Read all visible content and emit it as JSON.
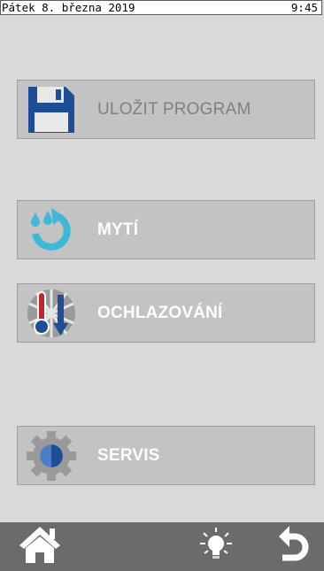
{
  "status_bar": {
    "date": "Pátek 8. března 2019",
    "time": "9:45"
  },
  "menu": {
    "save_program": {
      "label": "ULOŽIT PROGRAM",
      "icon": "floppy-disk-icon",
      "enabled": false
    },
    "wash": {
      "label": "MYTÍ",
      "icon": "wash-cycle-icon",
      "enabled": true
    },
    "cooling": {
      "label": "OCHLAZOVÁNÍ",
      "icon": "cooling-thermometer-icon",
      "enabled": true
    },
    "service": {
      "label": "SERVIS",
      "icon": "gear-icon",
      "enabled": true
    }
  },
  "bottom_bar": {
    "home": "home-icon",
    "light": "light-bulb-icon",
    "back": "back-arrow-icon"
  },
  "colors": {
    "background": "#d9d9d9",
    "button": "#c3c3c3",
    "bottom_bar": "#6b6b6b",
    "accent_blue": "#1f4e99",
    "accent_cyan": "#3db8d6",
    "accent_red": "#c0282d"
  }
}
